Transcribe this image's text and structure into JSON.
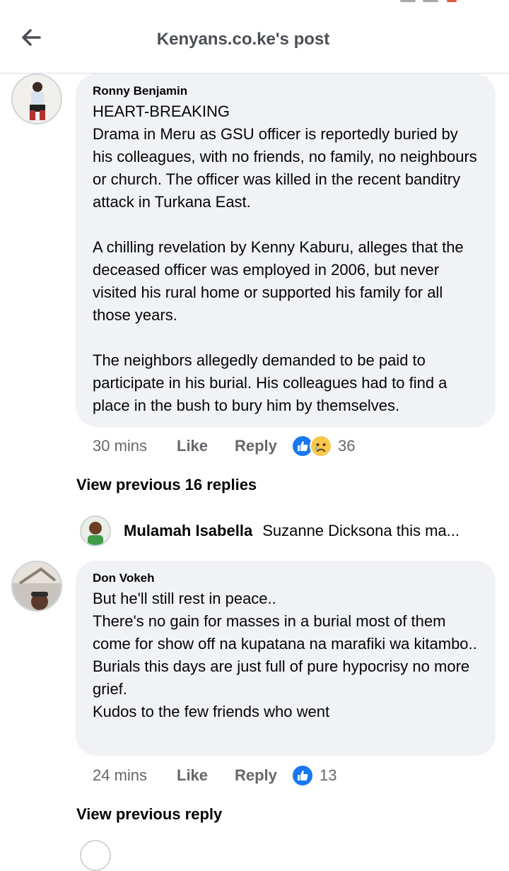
{
  "header": {
    "title": "Kenyans.co.ke's post"
  },
  "comments": [
    {
      "author": "Ronny Benjamin",
      "text": "HEART-BREAKING\nDrama in Meru as GSU officer is reportedly buried by his colleagues, with no friends, no family, no neighbours or church. The officer was killed in the recent banditry attack in Turkana East.\n\nA chilling revelation by Kenny Kaburu, alleges that the deceased officer was employed in 2006, but never visited his rural home or supported his family for all those years.\n\nThe neighbors allegedly demanded to be paid to participate in his burial. His colleagues had to find a place in the bush to bury him by themselves.",
      "time": "30 mins",
      "like_label": "Like",
      "reply_label": "Reply",
      "reaction_icons": [
        "like-icon",
        "sad-icon"
      ],
      "reaction_count": "36",
      "view_replies": "View previous 16 replies",
      "reply_preview": {
        "author": "Mulamah Isabella",
        "text": "Suzanne Dicksona this ma..."
      }
    },
    {
      "author": "Don Vokeh",
      "text": "But he'll still rest in peace..\nThere's no gain for masses in a burial most of them come for show off na kupatana na marafiki wa kitambo..\nBurials this days are just full of pure hypocrisy no more grief.\nKudos to the few friends who went",
      "time": "24 mins",
      "like_label": "Like",
      "reply_label": "Reply",
      "reaction_icons": [
        "like-icon"
      ],
      "reaction_count": "13",
      "view_replies": "View previous reply"
    }
  ],
  "colors": {
    "bubble": "#f0f2f5",
    "like_blue": "#1877f2",
    "sad_yellow": "#f7c84c",
    "meta_gray": "#65676b"
  }
}
